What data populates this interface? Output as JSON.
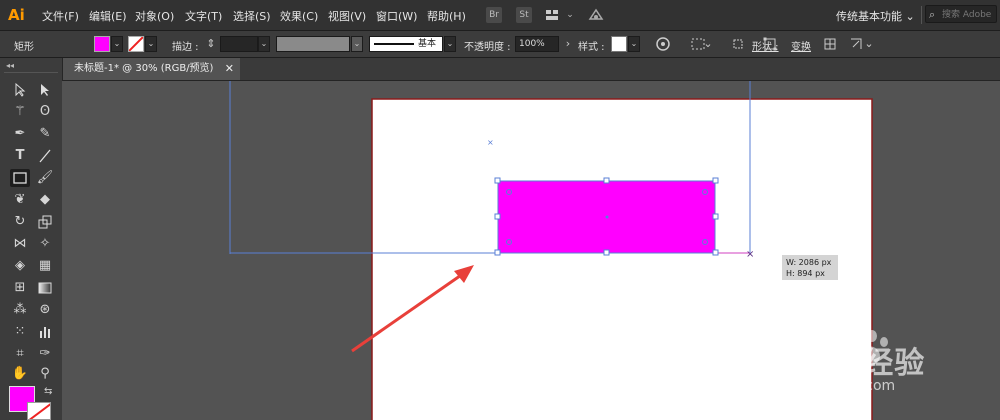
{
  "app": {
    "logo": "Ai"
  },
  "menu": [
    "文件(F)",
    "编辑(E)",
    "对象(O)",
    "文字(T)",
    "选择(S)",
    "效果(C)",
    "视图(V)",
    "窗口(W)",
    "帮助(H)"
  ],
  "menubar_icons": {
    "br": "Br",
    "st": "St"
  },
  "workspace": {
    "label": "传统基本功能"
  },
  "search": {
    "placeholder": "搜索 Adobe"
  },
  "control": {
    "selection_label": "矩形",
    "fill_color": "#ff00ff",
    "stroke_label": "描边 :",
    "brush_label": "基本",
    "opacity_label": "不透明度 :",
    "opacity_value": "100%",
    "style_label": "样式 :",
    "shape_label": "形状 :",
    "transform_label": "变换"
  },
  "document": {
    "tab_title": "未标题-1* @ 30% (RGB/预览)"
  },
  "canvas": {
    "rect_fill": "#ff00ff",
    "artboard_border": "#8b1a1a",
    "guide_color": "#5a7fd6",
    "arrow_color": "#e8403a"
  },
  "tooltip": {
    "w_text": "W: 2086 px",
    "h_text": "H: 894 px"
  },
  "watermark": {
    "brand": "Baidu经验",
    "url": "jingyan.baidu.com"
  }
}
